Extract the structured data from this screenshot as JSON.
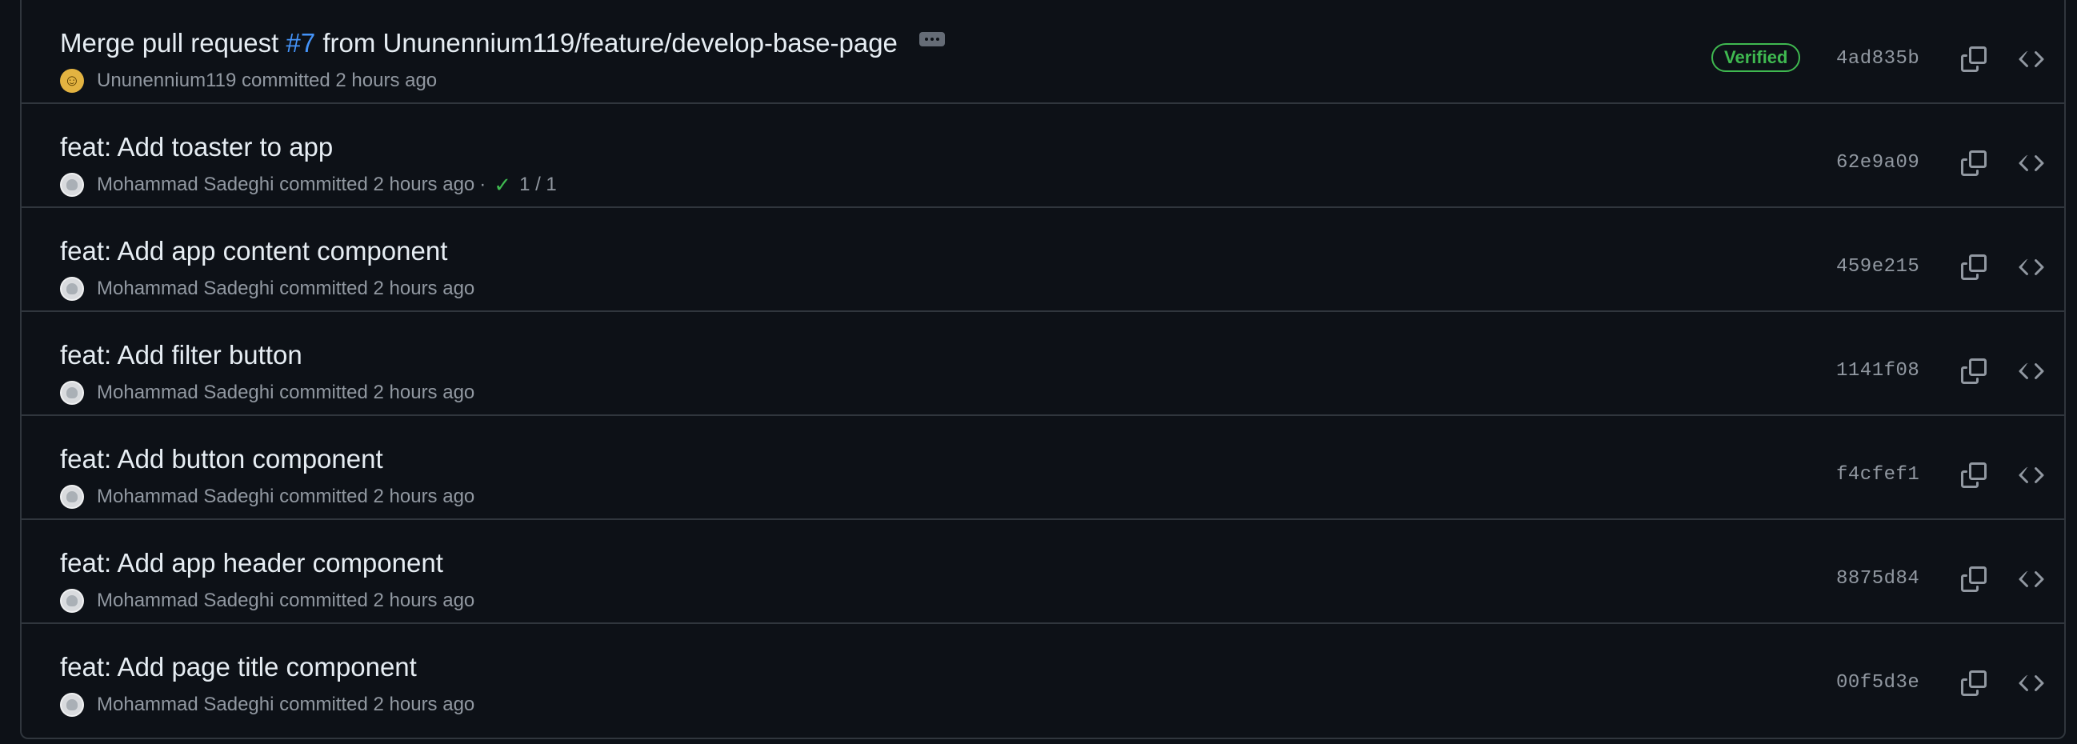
{
  "commits": [
    {
      "title_prefix": "Merge pull request ",
      "pr_number": "#7",
      "title_suffix": " from Ununennium119/feature/develop-base-page",
      "title": "",
      "author": "Ununennium119",
      "meta_text": "committed 2 hours ago",
      "checks": "",
      "verified": "Verified",
      "sha": "4ad835b",
      "avatar": "smiley-avatar"
    },
    {
      "title": "feat: Add toaster to app",
      "author": "Mohammad Sadeghi",
      "meta_text": "committed 2 hours ago",
      "checks": "1 / 1",
      "sha": "62e9a09"
    },
    {
      "title": "feat: Add app content component",
      "author": "Mohammad Sadeghi",
      "meta_text": "committed 2 hours ago",
      "sha": "459e215"
    },
    {
      "title": "feat: Add filter button",
      "author": "Mohammad Sadeghi",
      "meta_text": "committed 2 hours ago",
      "sha": "1141f08"
    },
    {
      "title": "feat: Add button component",
      "author": "Mohammad Sadeghi",
      "meta_text": "committed 2 hours ago",
      "sha": "f4cfef1"
    },
    {
      "title": "feat: Add app header component",
      "author": "Mohammad Sadeghi",
      "meta_text": "committed 2 hours ago",
      "sha": "8875d84"
    },
    {
      "title": "feat: Add page title component",
      "author": "Mohammad Sadeghi",
      "meta_text": "committed 2 hours ago",
      "sha": "00f5d3e"
    }
  ],
  "icons": {
    "copy": "copy-icon",
    "browse": "code-icon",
    "check": "check-icon",
    "ellipsis": "ellipsis-icon"
  },
  "colors": {
    "background": "#0d1117",
    "border": "#30363d",
    "text": "#e6edf3",
    "muted": "#9198a1",
    "link": "#4493f8",
    "success": "#3fb950"
  }
}
